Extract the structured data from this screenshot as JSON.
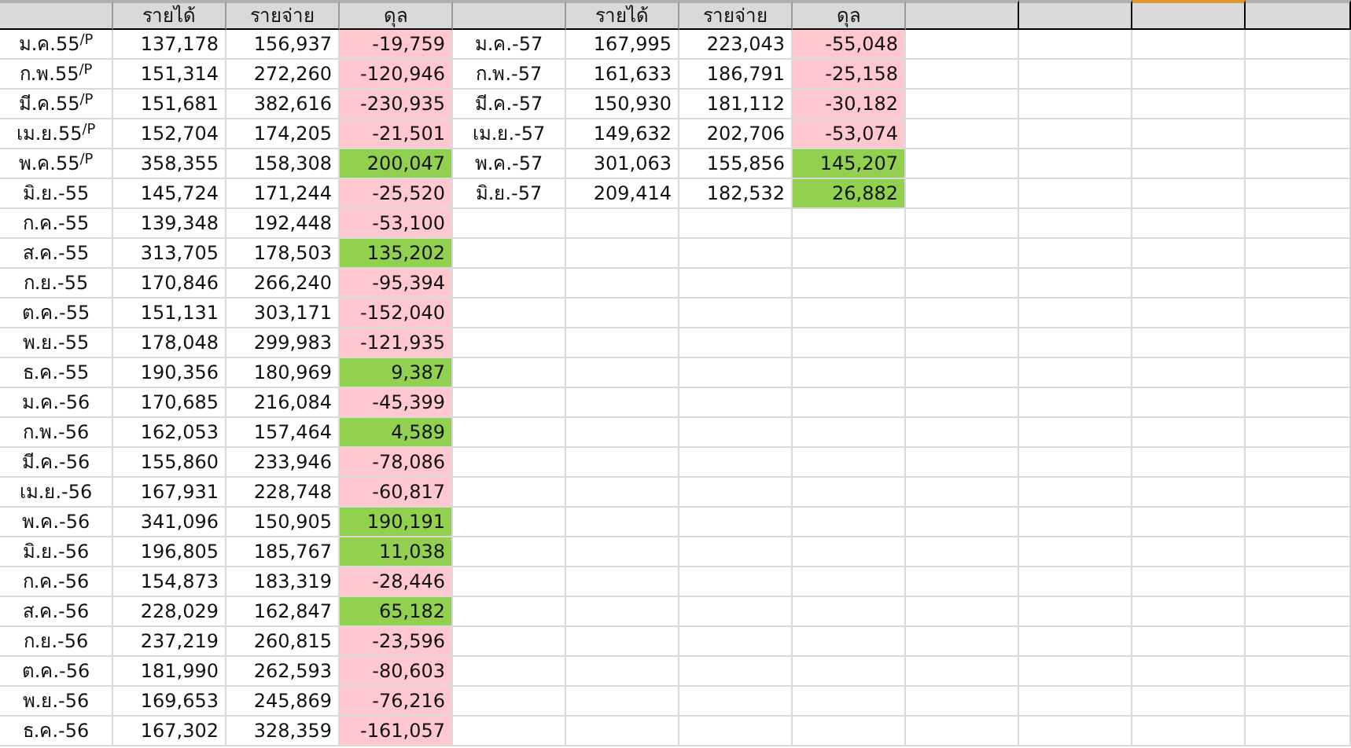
{
  "left_table": {
    "columns": [
      "รายได้",
      "รายจ่าย",
      "ดุล"
    ],
    "rows": [
      {
        "month": "ม.ค.55$^{/P}$",
        "income": "137,178",
        "expense": "156,937",
        "balance": "-19,759",
        "color": "#ffc7ce"
      },
      {
        "month": "ก.พ.55$^{/P}$",
        "income": "151,314",
        "expense": "272,260",
        "balance": "-120,946",
        "color": "#ffc7ce"
      },
      {
        "month": "มี.ค.55$^{/P}$",
        "income": "151,681",
        "expense": "382,616",
        "balance": "-230,935",
        "color": "#ffc7ce"
      },
      {
        "month": "เม.ย.55$^{/P}$",
        "income": "152,704",
        "expense": "174,205",
        "balance": "-21,501",
        "color": "#ffc7ce"
      },
      {
        "month": "พ.ค.55$^{/P}$",
        "income": "358,355",
        "expense": "158,308",
        "balance": "200,047",
        "color": "#92d050"
      },
      {
        "month": "มิ.ย.-55",
        "income": "145,724",
        "expense": "171,244",
        "balance": "-25,520",
        "color": "#ffc7ce"
      },
      {
        "month": "ก.ค.-55",
        "income": "139,348",
        "expense": "192,448",
        "balance": "-53,100",
        "color": "#ffc7ce"
      },
      {
        "month": "ส.ค.-55",
        "income": "313,705",
        "expense": "178,503",
        "balance": "135,202",
        "color": "#92d050"
      },
      {
        "month": "ก.ย.-55",
        "income": "170,846",
        "expense": "266,240",
        "balance": "-95,394",
        "color": "#ffc7ce"
      },
      {
        "month": "ต.ค.-55",
        "income": "151,131",
        "expense": "303,171",
        "balance": "-152,040",
        "color": "#ffc7ce"
      },
      {
        "month": "พ.ย.-55",
        "income": "178,048",
        "expense": "299,983",
        "balance": "-121,935",
        "color": "#ffc7ce"
      },
      {
        "month": "ธ.ค.-55",
        "income": "190,356",
        "expense": "180,969",
        "balance": "9,387",
        "color": "#92d050"
      },
      {
        "month": "ม.ค.-56",
        "income": "170,685",
        "expense": "216,084",
        "balance": "-45,399",
        "color": "#ffc7ce"
      },
      {
        "month": "ก.พ.-56",
        "income": "162,053",
        "expense": "157,464",
        "balance": "4,589",
        "color": "#92d050"
      },
      {
        "month": "มี.ค.-56",
        "income": "155,860",
        "expense": "233,946",
        "balance": "-78,086",
        "color": "#ffc7ce"
      },
      {
        "month": "เม.ย.-56",
        "income": "167,931",
        "expense": "228,748",
        "balance": "-60,817",
        "color": "#ffc7ce"
      },
      {
        "month": "พ.ค.-56",
        "income": "341,096",
        "expense": "150,905",
        "balance": "190,191",
        "color": "#92d050"
      },
      {
        "month": "มิ.ย.-56",
        "income": "196,805",
        "expense": "185,767",
        "balance": "11,038",
        "color": "#92d050"
      },
      {
        "month": "ก.ค.-56",
        "income": "154,873",
        "expense": "183,319",
        "balance": "-28,446",
        "color": "#ffc7ce"
      },
      {
        "month": "ส.ค.-56",
        "income": "228,029",
        "expense": "162,847",
        "balance": "65,182",
        "color": "#92d050"
      },
      {
        "month": "ก.ย.-56",
        "income": "237,219",
        "expense": "260,815",
        "balance": "-23,596",
        "color": "#ffc7ce"
      },
      {
        "month": "ต.ค.-56",
        "income": "181,990",
        "expense": "262,593",
        "balance": "-80,603",
        "color": "#ffc7ce"
      },
      {
        "month": "พ.ย.-56",
        "income": "169,653",
        "expense": "245,869",
        "balance": "-76,216",
        "color": "#ffc7ce"
      },
      {
        "month": "ธ.ค.-56",
        "income": "167,302",
        "expense": "328,359",
        "balance": "-161,057",
        "color": "#ffc7ce"
      }
    ]
  },
  "right_table": {
    "columns": [
      "รายได้",
      "รายจ่าย",
      "ดุล"
    ],
    "rows": [
      {
        "month": "ม.ค.-57",
        "income": "167,995",
        "expense": "223,043",
        "balance": "-55,048",
        "color": "#ffc7ce"
      },
      {
        "month": "ก.พ.-57",
        "income": "161,633",
        "expense": "186,791",
        "balance": "-25,158",
        "color": "#ffc7ce"
      },
      {
        "month": "มี.ค.-57",
        "income": "150,930",
        "expense": "181,112",
        "balance": "-30,182",
        "color": "#ffc7ce"
      },
      {
        "month": "เม.ย.-57",
        "income": "149,632",
        "expense": "202,706",
        "balance": "-53,074",
        "color": "#ffc7ce"
      },
      {
        "month": "พ.ค.-57",
        "income": "301,063",
        "expense": "155,856",
        "balance": "145,207",
        "color": "#92d050"
      },
      {
        "month": "มิ.ย.-57",
        "income": "209,414",
        "expense": "182,532",
        "balance": "26,882",
        "color": "#92d050"
      }
    ]
  },
  "blank_columns": [
    {
      "selected": false
    },
    {
      "selected": false
    },
    {
      "selected": true
    },
    {
      "selected": false
    }
  ]
}
